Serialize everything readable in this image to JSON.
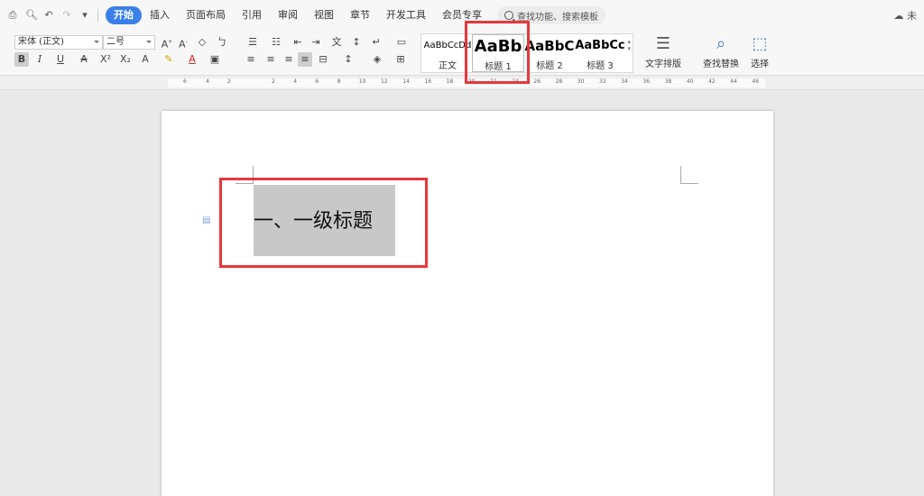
{
  "menubar": {
    "quick_icons": [
      "print-icon",
      "print-preview-icon",
      "undo-icon",
      "redo-icon",
      "customize-icon"
    ],
    "tabs": [
      {
        "label": "开始",
        "active": true
      },
      {
        "label": "插入",
        "active": false
      },
      {
        "label": "页面布局",
        "active": false
      },
      {
        "label": "引用",
        "active": false
      },
      {
        "label": "审阅",
        "active": false
      },
      {
        "label": "视图",
        "active": false
      },
      {
        "label": "章节",
        "active": false
      },
      {
        "label": "开发工具",
        "active": false
      },
      {
        "label": "会员专享",
        "active": false
      }
    ],
    "search_placeholder": "查找功能、搜索模板",
    "cloud_label": "未"
  },
  "ribbon": {
    "font_name": "宋体 (正文)",
    "font_size": "二号",
    "styles": [
      {
        "preview": "AaBbCcDd",
        "name": "正文"
      },
      {
        "preview": "AaBb",
        "name": "标题 1"
      },
      {
        "preview": "AaBbC",
        "name": "标题 2"
      },
      {
        "preview": "AaBbCc",
        "name": "标题 3"
      }
    ],
    "text_layout_label": "文字排版",
    "find_replace_label": "查找替换",
    "select_label": "选择"
  },
  "ruler": {
    "left_numbers": [
      "6",
      "4",
      "2"
    ],
    "right_numbers": [
      "2",
      "4",
      "6",
      "8",
      "10",
      "12",
      "14",
      "16",
      "18",
      "20",
      "22",
      "24",
      "26",
      "28",
      "30",
      "32",
      "34",
      "36",
      "38",
      "40",
      "42",
      "44",
      "46"
    ]
  },
  "document": {
    "heading": "一、一级标题"
  },
  "colors": {
    "accent": "#3a80e8",
    "highlight_box": "#e8373a",
    "selection": "#c8c8c8"
  }
}
